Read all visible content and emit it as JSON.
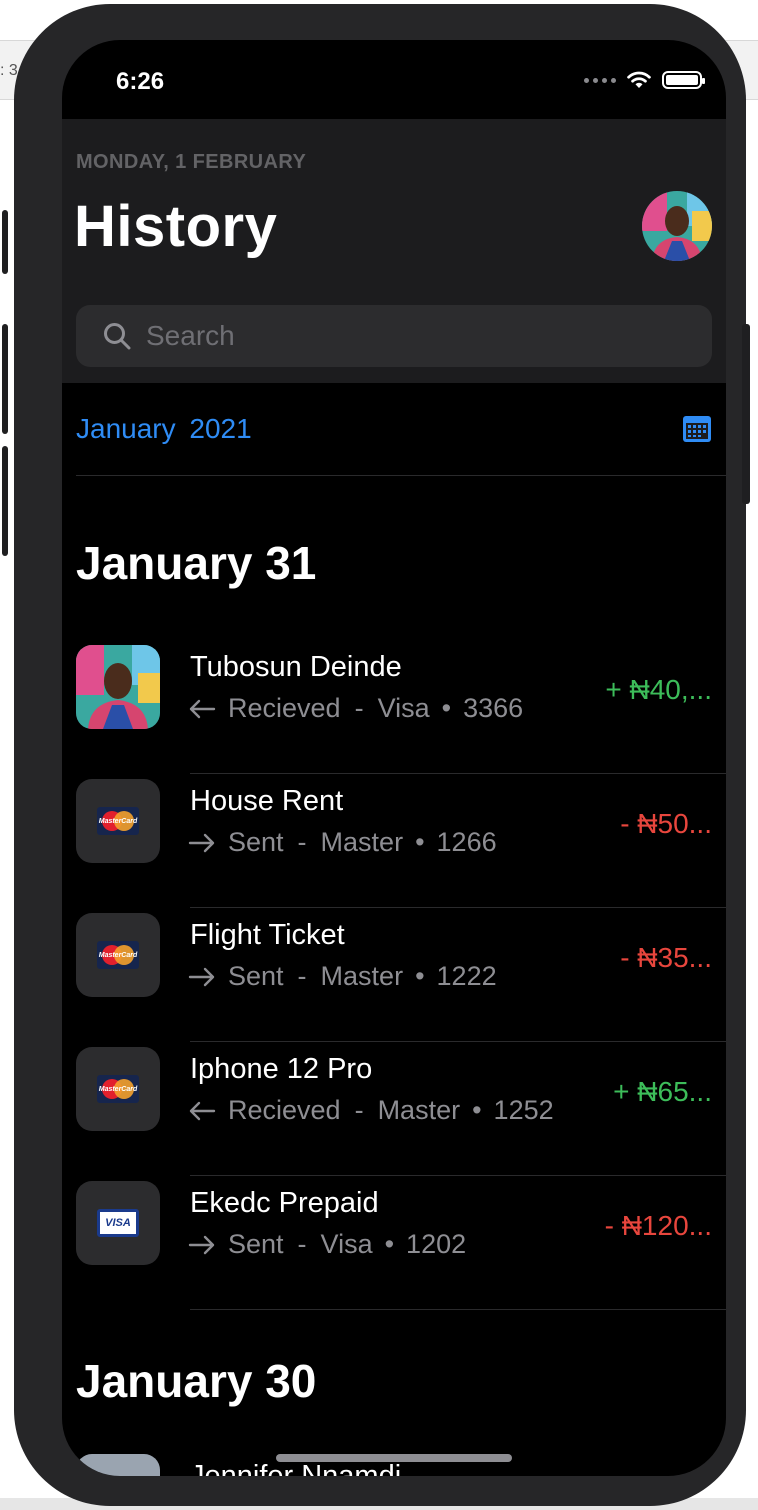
{
  "backdrop": {
    "fragment_text": ": 3"
  },
  "status_bar": {
    "time": "6:26"
  },
  "header": {
    "date": "MONDAY, 1 FEBRUARY",
    "title": "History"
  },
  "search": {
    "placeholder": "Search"
  },
  "month_filter": {
    "label": "January  2021"
  },
  "sections": [
    {
      "title": "January 31",
      "transactions": [
        {
          "name": "Tubosun Deinde",
          "direction": "Recieved",
          "card": "Visa",
          "last4": "3366",
          "amount": "+  ₦40,...",
          "type": "positive",
          "icon": "avatar-photo"
        },
        {
          "name": "House Rent",
          "direction": "Sent",
          "card": "Master",
          "last4": "1266",
          "amount": "-  ₦50...",
          "type": "negative",
          "icon": "mastercard-icon"
        },
        {
          "name": "Flight Ticket",
          "direction": "Sent",
          "card": "Master",
          "last4": "1222",
          "amount": "-  ₦35...",
          "type": "negative",
          "icon": "mastercard-icon"
        },
        {
          "name": "Iphone 12 Pro",
          "direction": "Recieved",
          "card": "Master",
          "last4": "1252",
          "amount": "+  ₦65...",
          "type": "positive",
          "icon": "mastercard-icon"
        },
        {
          "name": "Ekedc Prepaid",
          "direction": "Sent",
          "card": "Visa",
          "last4": "1202",
          "amount": "-  ₦120...",
          "type": "negative",
          "icon": "visa-icon"
        }
      ]
    },
    {
      "title": "January 30",
      "transactions": [
        {
          "name": "Jennifer Nnamdi...",
          "partial": true
        }
      ]
    }
  ],
  "separators": {
    "dash": "-",
    "dot": "•"
  },
  "card_labels": {
    "mastercard": "MasterCard",
    "visa": "VISA"
  },
  "colors": {
    "accent": "#2f8cf5",
    "positive": "#3dbd5a",
    "negative": "#e8463d",
    "header_bg": "#1c1c1e",
    "screen_bg": "#000000"
  }
}
